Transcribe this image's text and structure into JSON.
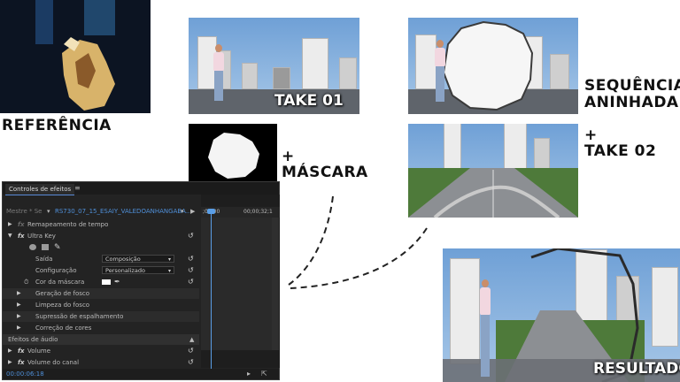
{
  "labels": {
    "referencia": "REFERÊNCIA",
    "take01": "TAKE 01",
    "mascara_plus": "+",
    "mascara": "MÁSCARA",
    "sequencia_l1": "SEQUÊNCIA",
    "sequencia_l2": "ANINHADA",
    "take02_plus": "+",
    "take02": "TAKE 02",
    "resultado": "RESULTADO"
  },
  "panel": {
    "title": "Controles de efeitos",
    "source_label": "Mestre * Se",
    "clip_name": "RS730_07_15_ESAIY_VALEDOANHANGABA...",
    "time_start": ";00;00",
    "time_end": "00;00;32;1",
    "rows": {
      "remap": "Remapeamento de tempo",
      "ultrakey": "Ultra Key",
      "saida": "Saída",
      "saida_val": "Composição",
      "config": "Configuração",
      "config_val": "Personalizado",
      "cor": "Cor da máscara",
      "geracao": "Geração de fosco",
      "limpeza": "Limpeza do fosco",
      "supressao": "Supressão de espalhamento",
      "correcao": "Correção de cores",
      "audio": "Efeitos de áudio",
      "volume": "Volume",
      "volume_canal": "Volume do canal"
    },
    "fx": "fx",
    "timecode": "00:00:06:18"
  },
  "colors": {
    "accent_blue": "#5a9ee6",
    "clip_name_blue": "#4f8fd8"
  }
}
